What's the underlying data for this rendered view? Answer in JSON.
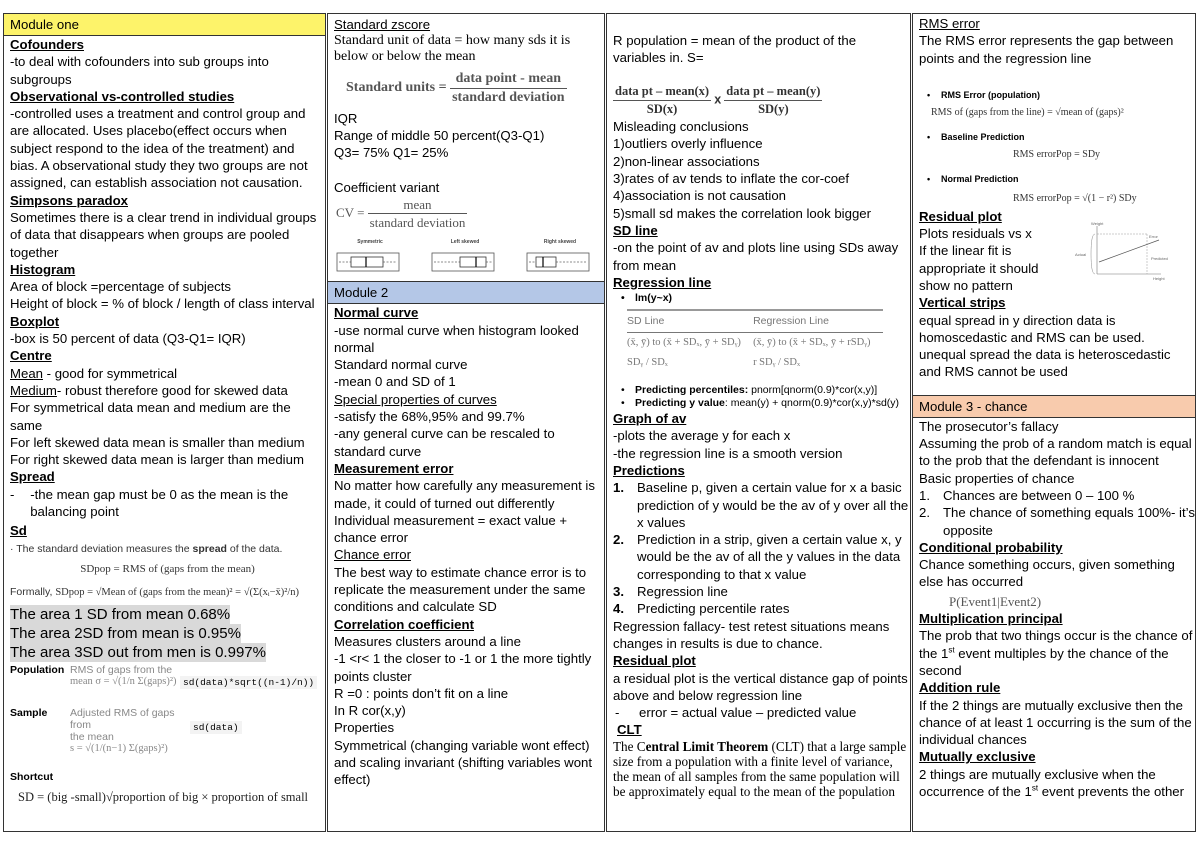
{
  "col1": {
    "header": "Module one",
    "cofounders_title": "Cofounders",
    "cofounders_text": "-to deal with cofounders into sub groups into subgroups",
    "obs_title": "Observational vs-controlled studies",
    "obs_text": "-controlled uses a treatment and control group and are allocated. Uses placebo(effect occurs when subject respond to  the idea of the treatment) and bias. A observational study they two groups are not assigned, can establish association not causation.",
    "simpsons_title": "Simpsons paradox",
    "simpsons_text": "Sometimes there is a clear trend in individual groups of data that disappears when groups are pooled together",
    "histogram_title": "Histogram",
    "histogram_l1": "Area of block =percentage of subjects",
    "histogram_l2": "Height of block = % of block / length of class interval",
    "boxplot_title": "Boxplot",
    "boxplot_text": "-box is 50 percent of data (Q3-Q1= IQR)",
    "centre_title": "Centre",
    "mean_label": "Mean",
    "mean_text": " - good for symmetrical",
    "medium_label": "Medium",
    "medium_text": "- robust therefore good for skewed data",
    "centre_l1": "For symmetrical data mean and medium are the same",
    "centre_l2": "For left skewed data mean is smaller than medium",
    "centre_l3": "For right skewed data mean is larger than medium",
    "spread_title": "Spread",
    "spread_dash": "-",
    "spread_text": "-the mean gap must be 0 as the mean is the balancing point",
    "sd_title": "Sd",
    "sd_bullet1_pre": "The standard deviation measures the ",
    "sd_bullet1_bold": "spread",
    "sd_bullet1_post": " of the data.",
    "sd_formula1": "SDpop = RMS of (gaps from the mean)",
    "sd_formula2_label": "Formally,",
    "sd_formula2": "SDpop = √Mean of (gaps from the mean)² = √(Σ(xᵢ−x̄)²/n)",
    "area1": "The area 1 SD from mean 0.68%",
    "area2": "The area 2SD from mean is 0.95%",
    "area3": "The area 3SD out from men is 0.997%",
    "population_label": "Population",
    "population_desc1": "RMS of gaps from the",
    "population_desc2": "mean σ = √(1/n Σ(gaps)²)",
    "population_code": "sd(data)*sqrt((n-1)/n))",
    "sample_label": "Sample",
    "sample_desc1": "Adjusted RMS of gaps from",
    "sample_desc2": "the mean",
    "sample_desc3": "s = √(1/(n−1) Σ(gaps)²)",
    "sample_code": "sd(data)",
    "shortcut_label": "Shortcut",
    "shortcut_formula": "SD = (big -small)√proportion of big × proportion of small"
  },
  "col2": {
    "zscore_title": "Standard zscore",
    "zscore_text": "Standard unit of data = how many sds it is below or below the mean",
    "su_label": "Standard units =",
    "su_num": "data point - mean",
    "su_den": "standard deviation",
    "iqr_title": "IQR",
    "iqr_l1": "Range of middle 50 percent(Q3-Q1)",
    "iqr_l2": "Q3= 75% Q1= 25%",
    "cv_title": "Coefficient variant",
    "cv_label": "CV =",
    "cv_num": "mean",
    "cv_den": "standard deviation",
    "boxplots": [
      {
        "title": "Symmetric",
        "ticks": [
          "1",
          "2",
          "3",
          "4",
          "5",
          "6",
          "7",
          "8"
        ]
      },
      {
        "title": "Left skewed",
        "ticks": [
          "2",
          "4",
          "6",
          "8",
          "10"
        ]
      },
      {
        "title": "Right skewed",
        "ticks": [
          "2",
          "4",
          "6",
          "8"
        ]
      }
    ],
    "header2": "Module 2",
    "normal_title": "Normal curve",
    "normal_l1": "-use normal curve when histogram looked normal",
    "normal_l2": "Standard normal curve",
    "normal_l3": "-mean 0 and SD of 1",
    "special_title": "Special properties of curves",
    "special_l1": "-satisfy the 68%,95% and 99.7%",
    "special_l2": "-any general curve can be rescaled to standard curve",
    "me_title": "Measurement error",
    "me_l1": "No matter how carefully any measurement is made, it could of turned out differently",
    "me_l2": "Individual measurement = exact value + chance error",
    "ce_title": "Chance error",
    "ce_text": "The best way to estimate chance error is to replicate the measurement under the same conditions and calculate SD",
    "cc_title": "Correlation coefficient",
    "cc_l1": "Measures clusters around a line",
    "cc_l2": "-1 <r< 1 the closer to -1 or 1 the more tightly points cluster",
    "cc_l3": "R =0 : points don’t fit on a line",
    "cc_l4": "In R cor(x,y)",
    "cc_l5": "Properties",
    "cc_l6": "Symmetrical (changing variable wont effect) and scaling invariant (shifting variables wont effect)"
  },
  "col3": {
    "rpop_text": "R population = mean of the product of the variables in. S=",
    "f1_num": "data pt – mean(x)",
    "f1_den": "SD(x)",
    "f_times": "x",
    "f2_num": "data pt – mean(y)",
    "f2_den": "SD(y)",
    "mis_title": "Misleading conclusions",
    "mis_items": [
      "1)outliers overly influence",
      "2)non-linear associations",
      "3)rates of av tends to inflate the cor-coef",
      "4)association is not causation",
      "5)small sd makes the correlation look bigger"
    ],
    "sdline_title": "SD line",
    "sdline_text": "-on the point of av and plots line using SDs away from mean",
    "reg_title": "Regression line",
    "reg_bullet": "lm(y~x)",
    "tbl_h1": "SD Line",
    "tbl_h2": "Regression Line",
    "tbl_r1c1": "(x̄, ȳ) to (x̄ + SDₓ, ȳ + SDᵧ)",
    "tbl_r1c2": "(x̄, ȳ) to (x̄ + SDₓ, ȳ + rSDᵧ)",
    "tbl_r2c1": "SDᵧ / SDₓ",
    "tbl_r2c2": "r SDᵧ / SDₓ",
    "pp_bold": "Predicting percentiles: ",
    "pp_text": "pnorm[qnorm(0.9)*cor(x,y)]",
    "py_bold": "Predicting y value",
    "py_text": ": mean(y) + qnorm(0.9)*cor(x,y)*sd(y)",
    "gav_title": "Graph of av",
    "gav_l1": "-plots the average y for each x",
    "gav_l2": "-the regression line is a smooth version",
    "pred_title": "Predictions",
    "pred_items": [
      {
        "n": "1.",
        "t": "Baseline p, given a certain value for x a basic prediction of y would be the av of y over all the x values"
      },
      {
        "n": "2.",
        "t": "Prediction in a strip, given a certain value x,  y would be the av of all the y values in the data corresponding to that x value"
      },
      {
        "n": "3.",
        "t": "Regression line"
      },
      {
        "n": "4.",
        "t": "Predicting percentile rates"
      }
    ],
    "fallacy_text": "Regression fallacy- test retest situations means changes in results is due to chance.",
    "resid_title": "Residual plot",
    "resid_text": "a residual plot is the vertical distance gap of points above and below regression line",
    "resid_dash": "-",
    "resid_bullet": "error = actual value – predicted value",
    "clt_title": "CLT",
    "clt_pre": "The C",
    "clt_bold": "entral Limit Theorem",
    "clt_post": " (CLT) that a large sample size from a population with a finite level of variance, the mean of all samples from the same population will be approximately equal to the mean of the population"
  },
  "col4": {
    "rms_title": "RMS error",
    "rms_text": "The RMS error represents the gap between points and the regression line",
    "b1_title": "RMS Error (population)",
    "b1_formula": "RMS of (gaps from the line) = √mean of (gaps)²",
    "b2_title": "Baseline Prediction",
    "b2_formula": "RMS errorPop = SDy",
    "b3_title": "Normal Prediction",
    "b3_formula": "RMS errorPop = √(1 − r²) SDy",
    "resid_title": "Residual plot",
    "resid_l1": "Plots residuals vs x",
    "resid_l2": "If the linear fit is appropriate it should show no pattern",
    "diagram_labels": {
      "weight_top": "Weight",
      "error": "Error",
      "actual": "Actual",
      "predicted": "Predicted",
      "height": "Height"
    },
    "vs_title": "Vertical strips",
    "vs_text": "equal spread in y direction data is homoscedastic and RMS can be used. unequal spread the data is heteroscedastic and RMS cannot be used",
    "header3": "Module 3 - chance",
    "pf_title": "The prosecutor’s fallacy",
    "pf_text": "Assuming the prob of a random match is equal to the prob that the defendant is innocent",
    "basic_title": "Basic properties of chance",
    "basic_items": [
      {
        "n": "1.",
        "t": "Chances are between 0 – 100 %"
      },
      {
        "n": "2.",
        "t": "The chance of something equals 100%- it’s opposite"
      }
    ],
    "cond_title": "Conditional probability",
    "cond_text": "Chance something occurs, given something else has occurred",
    "cond_formula": "P(Event1|Event2)",
    "mult_title": "Multiplication principal",
    "mult_pre": "The prob that two things occur is the chance of the 1",
    "mult_sup": "st",
    "mult_post": " event multiples by the chance of the second",
    "add_title": "Addition rule",
    "add_text": "If the 2 things are mutually exclusive then the chance of at least 1 occurring is the sum of the individual chances",
    "me_title": "Mutually exclusive",
    "me_pre": "2 things are mutually exclusive when the occurrence of the 1",
    "me_sup": "st",
    "me_post": " event prevents the other"
  },
  "colors": {
    "module1": "#fdf36a",
    "module2": "#b4c7e7",
    "module3": "#f8cbad"
  }
}
